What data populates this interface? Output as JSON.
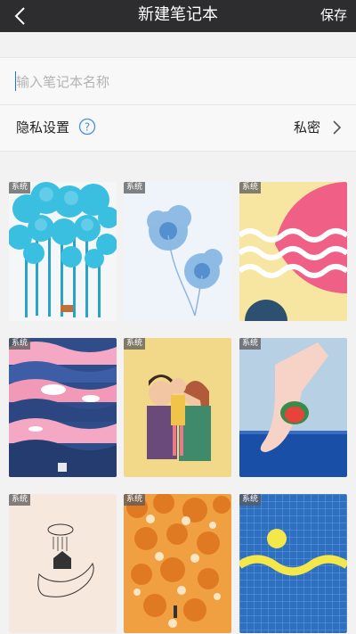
{
  "header": {
    "back_icon": "chevron-left-icon",
    "title": "新建笔记本",
    "save_label": "保存",
    "background": "#2d2d2f"
  },
  "name_field": {
    "value": "",
    "placeholder": "输入笔记本名称"
  },
  "privacy": {
    "label": "隐私设置",
    "help_icon": "question-circle-icon",
    "value": "私密",
    "chevron_icon": "chevron-right-icon"
  },
  "covers": [
    {
      "badge": "系统",
      "theme": "blue-trees"
    },
    {
      "badge": "系统",
      "theme": "blue-flowers"
    },
    {
      "badge": "系统",
      "theme": "pink-waves"
    },
    {
      "badge": "系统",
      "theme": "whale-waves"
    },
    {
      "badge": "系统",
      "theme": "hugging-couple"
    },
    {
      "badge": "系统",
      "theme": "foot-watermelon"
    },
    {
      "badge": "系统",
      "theme": "hand-house"
    },
    {
      "badge": "系统",
      "theme": "autumn-leaves"
    },
    {
      "badge": "系统",
      "theme": "blue-grid-wave"
    }
  ]
}
